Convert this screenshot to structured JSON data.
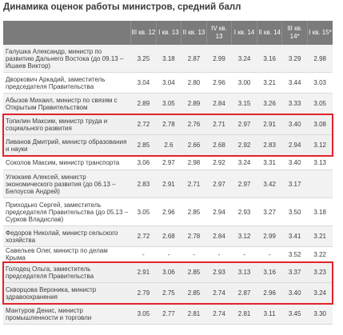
{
  "title": "Динамика оценок работы министров, средний балл",
  "headers": [
    "",
    "III кв. 12",
    "I кв. 13",
    "II кв. 13",
    "IV кв. 13",
    "I кв. 14",
    "II кв. 14",
    "III кв. 14*",
    "I кв. 15*"
  ],
  "rows": [
    {
      "name": "Галушка Александр, министр по развитию Дальнего Востока (до 09.13 – Ишаев Виктор)",
      "values": [
        "3.25",
        "3.18",
        "2.87",
        "2.99",
        "3.24",
        "3.16",
        "3.29",
        "2.98"
      ]
    },
    {
      "name": "Дворкович Аркадий, заместитель председателя Правительства",
      "values": [
        "3.04",
        "3.04",
        "2.80",
        "2.96",
        "3.00",
        "3.21",
        "3.44",
        "3.03"
      ]
    },
    {
      "name": "Абызов Михаил, министр по связям с Открытым Правительством",
      "values": [
        "2.89",
        "3.05",
        "2.89",
        "2.84",
        "3.15",
        "3.26",
        "3.33",
        "3.05"
      ]
    },
    {
      "name": "Топилин Максим, министр труда и социального развития",
      "values": [
        "2.72",
        "2.78",
        "2.76",
        "2.71",
        "2.97",
        "2.91",
        "3.40",
        "3.08"
      ]
    },
    {
      "name": "Ливанов Дмитрий, министр образования и науки",
      "values": [
        "2.85",
        "2.6",
        "2.66",
        "2.68",
        "2.92",
        "2.83",
        "2.94",
        "3.12"
      ]
    },
    {
      "name": "Соколов Максим, министр транспорта",
      "values": [
        "3.06",
        "2.97",
        "2.98",
        "2.92",
        "3.24",
        "3.31",
        "3.40",
        "3.13"
      ]
    },
    {
      "name": "Улюкаев Алексей, министр экономического развития (до 06.13 – Белоусов Андрей)",
      "values": [
        "2.83",
        "2.91",
        "2.71",
        "2.97",
        "2.97",
        "3.42",
        "3.17"
      ]
    },
    {
      "name": "Приходько Сергей, заместитель председателя Правительства (до 05.13 – Сурков Владислав)",
      "values": [
        "3.05",
        "2.96",
        "2.85",
        "2.94",
        "2.93",
        "3.27",
        "3.50",
        "3.18"
      ]
    },
    {
      "name": "Федоров Николай, министр сельского хозяйства",
      "values": [
        "2.72",
        "2.68",
        "2.78",
        "2.84",
        "3.12",
        "2.99",
        "3.41",
        "3.21"
      ]
    },
    {
      "name": "Савельев Олег, министр по делам Крыма",
      "values": [
        "-",
        "-",
        "-",
        "-",
        "-",
        "-",
        "3.52",
        "3.22"
      ]
    },
    {
      "name": "Голодец Ольга, заместитель председателя Правительства",
      "values": [
        "2.91",
        "3.06",
        "2.85",
        "2.93",
        "3.13",
        "3.16",
        "3.37",
        "3.23"
      ]
    },
    {
      "name": "Скворцова Вероника, министр здравоохранения",
      "values": [
        "2.79",
        "2.75",
        "2.85",
        "2.74",
        "2.87",
        "2.96",
        "3.40",
        "3.24"
      ]
    },
    {
      "name": "Мантуров Денис, министр промышленности и торговли",
      "values": [
        "3.05",
        "2.77",
        "2.81",
        "2.74",
        "2.81",
        "3.11",
        "3.45",
        "3.30"
      ]
    }
  ],
  "highlight_color": "#e0242c"
}
